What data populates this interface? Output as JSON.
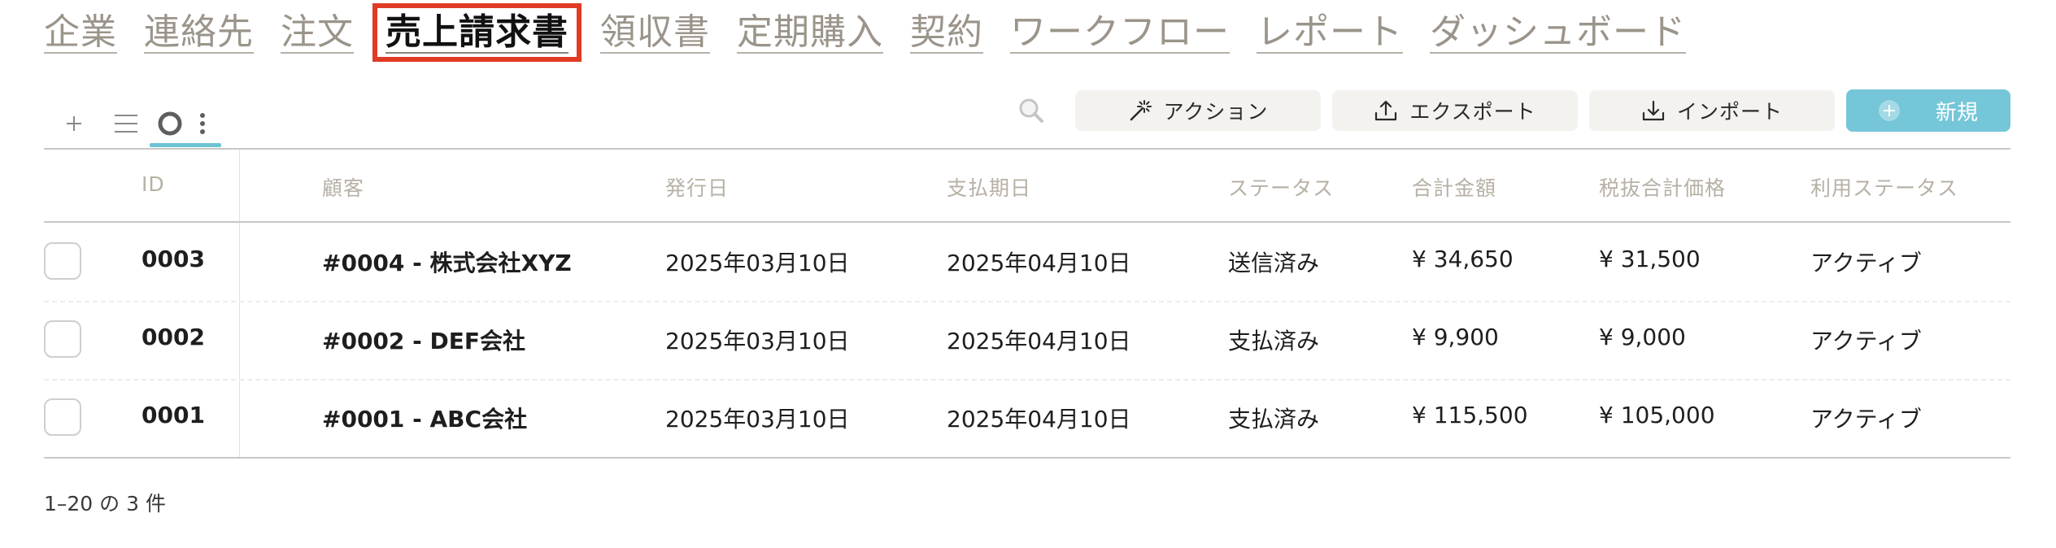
{
  "nav": {
    "tabs": [
      {
        "label": "企業"
      },
      {
        "label": "連絡先"
      },
      {
        "label": "注文"
      },
      {
        "label": "売上請求書"
      },
      {
        "label": "領収書"
      },
      {
        "label": "定期購入"
      },
      {
        "label": "契約"
      },
      {
        "label": "ワークフロー"
      },
      {
        "label": "レポート"
      },
      {
        "label": "ダッシュボード"
      }
    ],
    "active_index": 3
  },
  "toolbar": {
    "add_icon": "plus-icon",
    "list_icon": "list-view-icon",
    "circle_icon": "circle-view-icon",
    "more_icon": "more-vertical-icon",
    "search_icon": "search-icon",
    "action_label": "アクション",
    "export_label": "エクスポート",
    "import_label": "インポート",
    "new_label": "新規"
  },
  "colors": {
    "accent": "#74c6d8",
    "highlight_border": "#e03b24",
    "header_text": "#b7b0a5"
  },
  "table": {
    "headers": [
      "ID",
      "顧客",
      "発行日",
      "支払期日",
      "ステータス",
      "合計金額",
      "税抜合計価格",
      "利用ステータス"
    ],
    "rows": [
      {
        "id": "0003",
        "customer": "#0004 - 株式会社XYZ",
        "issue_date": "2025年03月10日",
        "due_date": "2025年04月10日",
        "status": "送信済み",
        "total": "¥ 34,650",
        "subtotal": "¥ 31,500",
        "usage_status": "アクティブ"
      },
      {
        "id": "0002",
        "customer": "#0002 - DEF会社",
        "issue_date": "2025年03月10日",
        "due_date": "2025年04月10日",
        "status": "支払済み",
        "total": "¥ 9,900",
        "subtotal": "¥ 9,000",
        "usage_status": "アクティブ"
      },
      {
        "id": "0001",
        "customer": "#0001 - ABC会社",
        "issue_date": "2025年03月10日",
        "due_date": "2025年04月10日",
        "status": "支払済み",
        "total": "¥ 115,500",
        "subtotal": "¥ 105,000",
        "usage_status": "アクティブ"
      }
    ]
  },
  "footer": {
    "pagination": "1–20 の 3 件"
  }
}
